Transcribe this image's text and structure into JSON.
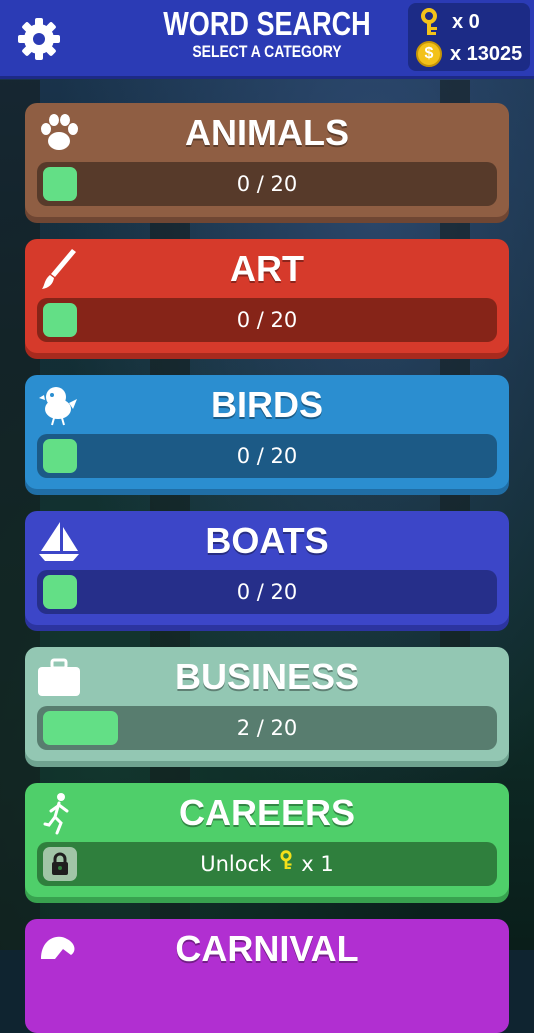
{
  "header": {
    "title": "WORD SEARCH",
    "subtitle": "SELECT A CATEGORY",
    "keys_count": "x 0",
    "coins_count": "x 13025",
    "coin_symbol": "$"
  },
  "categories": [
    {
      "name": "ANIMALS",
      "progress_text": "0 / 20",
      "progress": 0,
      "color": "#8f5e43",
      "shadow": "#6f4633",
      "bar_color": "#573a2a",
      "icon": "paw-icon"
    },
    {
      "name": "ART",
      "progress_text": "0 / 20",
      "progress": 0,
      "color": "#d63a2b",
      "shadow": "#a82a1e",
      "bar_color": "#862418",
      "icon": "paintbrush-icon"
    },
    {
      "name": "BIRDS",
      "progress_text": "0 / 20",
      "progress": 0,
      "color": "#2b8ed0",
      "shadow": "#206ea6",
      "bar_color": "#1c5a86",
      "icon": "bird-icon"
    },
    {
      "name": "BOATS",
      "progress_text": "0 / 20",
      "progress": 0,
      "color": "#3c46c8",
      "shadow": "#2c34a0",
      "bar_color": "#262f8a",
      "icon": "sailboat-icon"
    },
    {
      "name": "BUSINESS",
      "progress_text": "2 / 20",
      "progress": 0.1,
      "color": "#93c7b3",
      "shadow": "#6fa390",
      "bar_color": "#587d6f",
      "icon": "briefcase-icon"
    },
    {
      "name": "CAREERS",
      "progress_text": "Unlock",
      "unlock_cost": "x 1",
      "locked": true,
      "color": "#4fcf6a",
      "shadow": "#38a24f",
      "bar_color": "#2f7f3d",
      "icon": "runner-icon"
    },
    {
      "name": "CARNIVAL",
      "color": "#b12fd1",
      "icon": "carnival-icon"
    }
  ]
}
